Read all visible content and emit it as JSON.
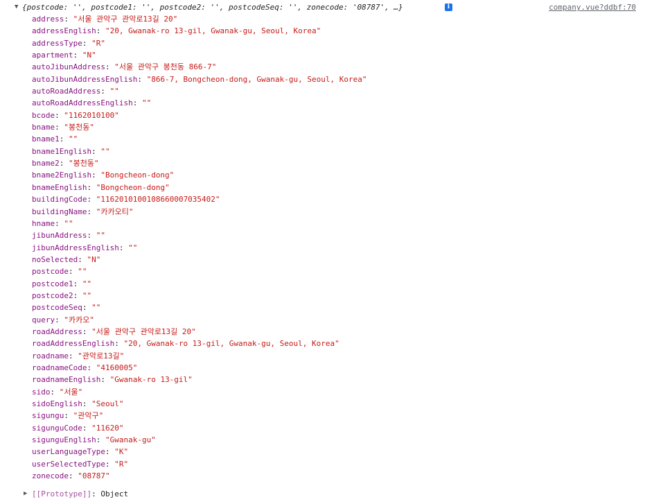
{
  "summary": {
    "toggle": "▼",
    "text": "{postcode: '', postcode1: '', postcode2: '', postcodeSeq: '', zonecode: '08787', …}",
    "info_icon": "i",
    "source_link": "company.vue?ddbf:70"
  },
  "properties": [
    {
      "key": "address",
      "value": "\"서울 관악구 관악로13길 20\""
    },
    {
      "key": "addressEnglish",
      "value": "\"20, Gwanak-ro 13-gil, Gwanak-gu, Seoul, Korea\""
    },
    {
      "key": "addressType",
      "value": "\"R\""
    },
    {
      "key": "apartment",
      "value": "\"N\""
    },
    {
      "key": "autoJibunAddress",
      "value": "\"서울 관악구 봉천동 866-7\""
    },
    {
      "key": "autoJibunAddressEnglish",
      "value": "\"866-7, Bongcheon-dong, Gwanak-gu, Seoul, Korea\""
    },
    {
      "key": "autoRoadAddress",
      "value": "\"\""
    },
    {
      "key": "autoRoadAddressEnglish",
      "value": "\"\""
    },
    {
      "key": "bcode",
      "value": "\"1162010100\""
    },
    {
      "key": "bname",
      "value": "\"봉천동\""
    },
    {
      "key": "bname1",
      "value": "\"\""
    },
    {
      "key": "bname1English",
      "value": "\"\""
    },
    {
      "key": "bname2",
      "value": "\"봉천동\""
    },
    {
      "key": "bname2English",
      "value": "\"Bongcheon-dong\""
    },
    {
      "key": "bnameEnglish",
      "value": "\"Bongcheon-dong\""
    },
    {
      "key": "buildingCode",
      "value": "\"1162010100108660007035402\""
    },
    {
      "key": "buildingName",
      "value": "\"카카오티\""
    },
    {
      "key": "hname",
      "value": "\"\""
    },
    {
      "key": "jibunAddress",
      "value": "\"\""
    },
    {
      "key": "jibunAddressEnglish",
      "value": "\"\""
    },
    {
      "key": "noSelected",
      "value": "\"N\""
    },
    {
      "key": "postcode",
      "value": "\"\""
    },
    {
      "key": "postcode1",
      "value": "\"\""
    },
    {
      "key": "postcode2",
      "value": "\"\""
    },
    {
      "key": "postcodeSeq",
      "value": "\"\""
    },
    {
      "key": "query",
      "value": "\"카카오\""
    },
    {
      "key": "roadAddress",
      "value": "\"서울 관악구 관악로13길 20\""
    },
    {
      "key": "roadAddressEnglish",
      "value": "\"20, Gwanak-ro 13-gil, Gwanak-gu, Seoul, Korea\""
    },
    {
      "key": "roadname",
      "value": "\"관악로13길\""
    },
    {
      "key": "roadnameCode",
      "value": "\"4160005\""
    },
    {
      "key": "roadnameEnglish",
      "value": "\"Gwanak-ro 13-gil\""
    },
    {
      "key": "sido",
      "value": "\"서울\""
    },
    {
      "key": "sidoEnglish",
      "value": "\"Seoul\""
    },
    {
      "key": "sigungu",
      "value": "\"관악구\""
    },
    {
      "key": "sigunguCode",
      "value": "\"11620\""
    },
    {
      "key": "sigunguEnglish",
      "value": "\"Gwanak-gu\""
    },
    {
      "key": "userLanguageType",
      "value": "\"K\""
    },
    {
      "key": "userSelectedType",
      "value": "\"R\""
    },
    {
      "key": "zonecode",
      "value": "\"08787\""
    }
  ],
  "prototype": {
    "toggle": "▶",
    "key": "[[Prototype]]",
    "value": "Object"
  },
  "colors": {
    "key": "#881280",
    "string": "#c41a16",
    "info_badge": "#1a73e8"
  }
}
